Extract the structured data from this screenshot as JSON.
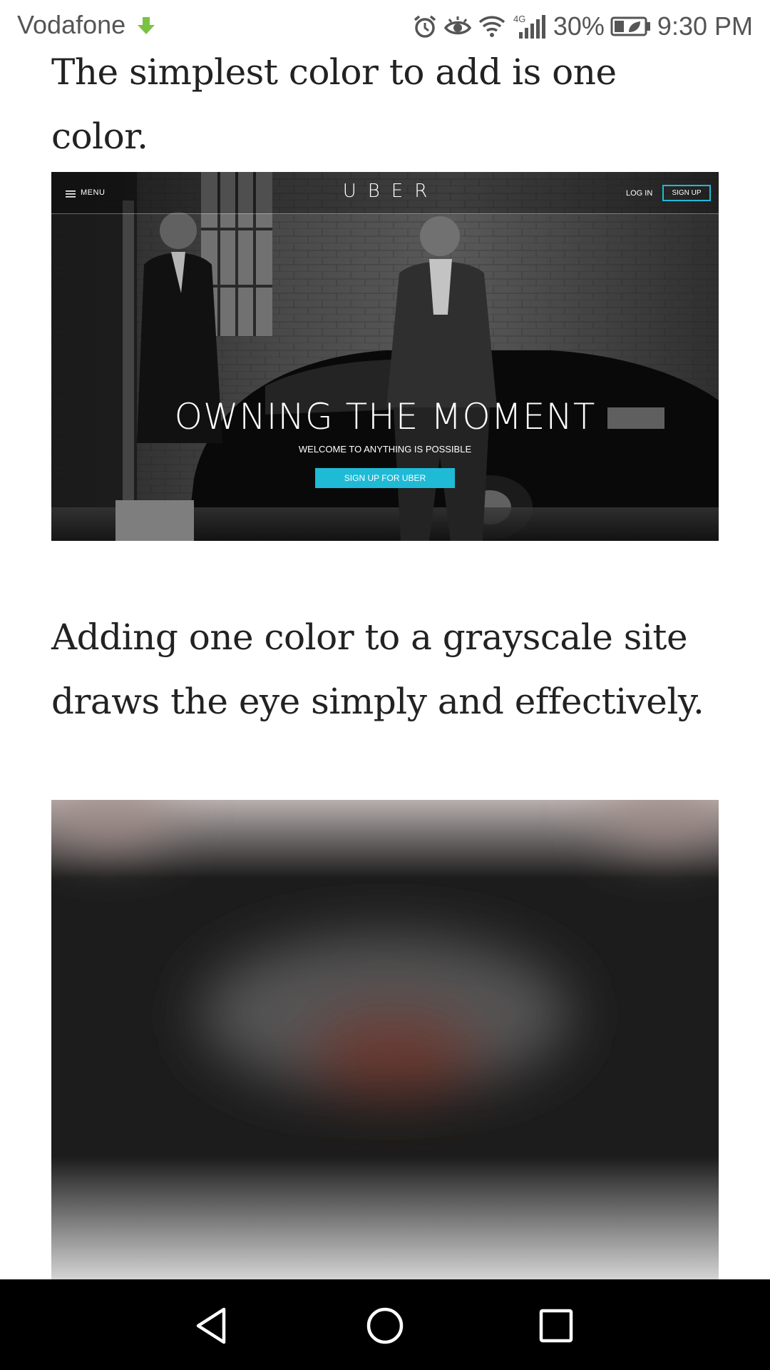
{
  "status_bar": {
    "carrier": "Vodafone",
    "network": "4G",
    "battery": "30%",
    "time": "9:30 PM",
    "icons": [
      "download-icon",
      "alarm-icon",
      "eye-comfort-icon",
      "wifi-icon",
      "signal-icon",
      "battery-saver-icon"
    ]
  },
  "article": {
    "paragraph_1": "The simplest color to add is one color.",
    "paragraph_2": "Adding one color to a grayscale site draws the eye simply and effectively."
  },
  "uber_screenshot": {
    "menu_label": "MENU",
    "logo": "UBER",
    "login": "LOG IN",
    "signup": "SIGN UP",
    "headline": "OWNING THE MOMENT",
    "subheadline": "WELCOME TO ANYTHING IS POSSIBLE",
    "cta": "SIGN UP FOR UBER",
    "accent_color": "#1fbad6"
  },
  "navigation_bar": {
    "buttons": [
      "back-icon",
      "home-icon",
      "recent-apps-icon"
    ]
  }
}
